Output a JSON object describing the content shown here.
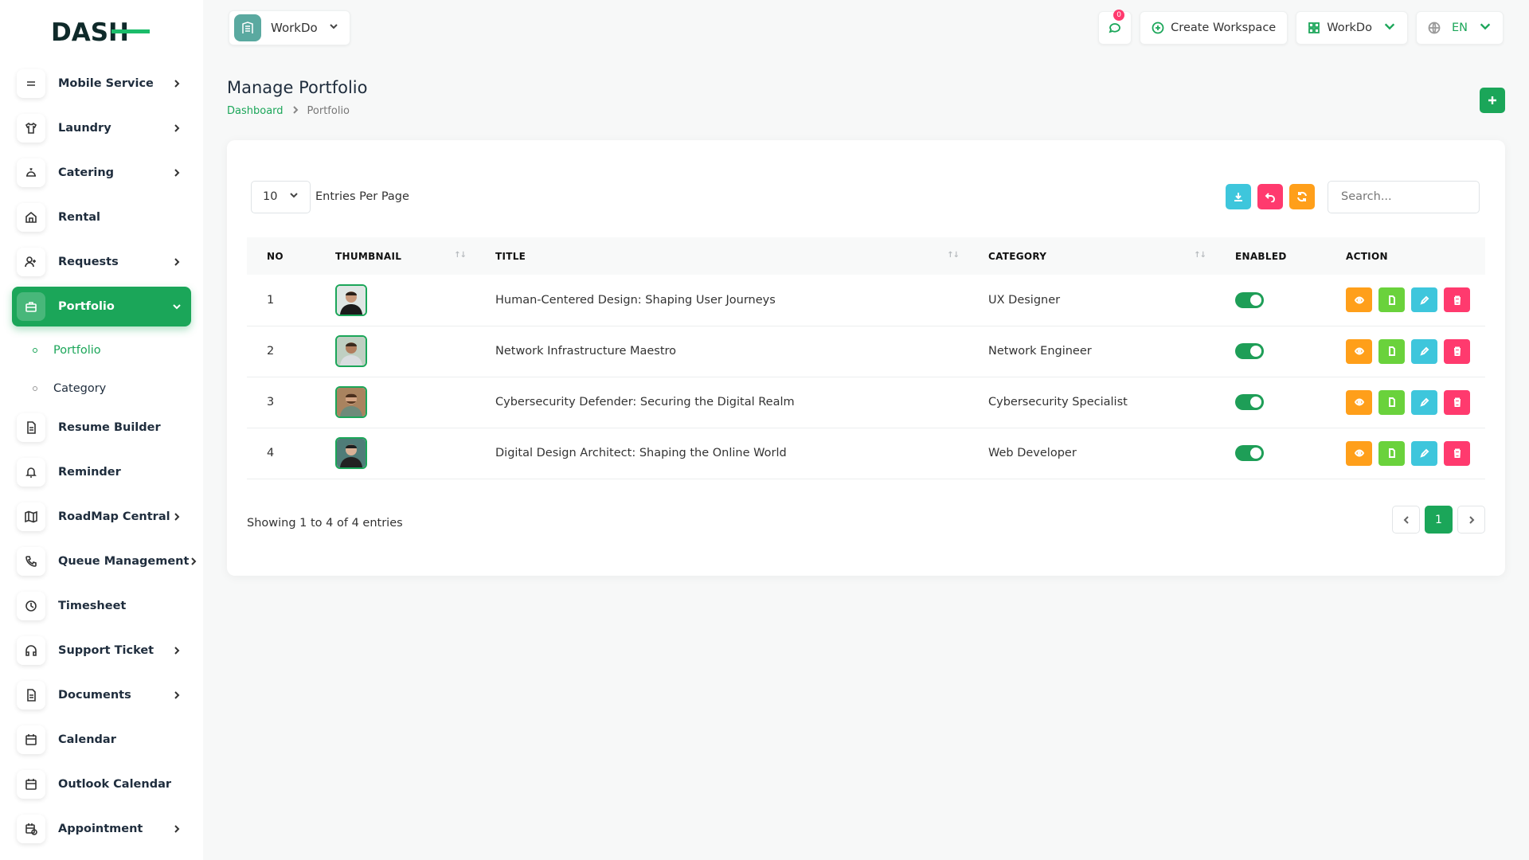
{
  "brand": {
    "logo_main": "DASH",
    "logo_tail": ""
  },
  "sidebar": {
    "items": [
      {
        "label": "Mobile Service",
        "icon": "menu-icon",
        "chevron": true
      },
      {
        "label": "Laundry",
        "icon": "shirt-icon",
        "chevron": true
      },
      {
        "label": "Catering",
        "icon": "tray-icon",
        "chevron": true
      },
      {
        "label": "Rental",
        "icon": "home-icon",
        "chevron": false
      },
      {
        "label": "Requests",
        "icon": "user-plus-icon",
        "chevron": true
      },
      {
        "label": "Portfolio",
        "icon": "briefcase-icon",
        "chevron": true,
        "active": true
      },
      {
        "label": "Resume Builder",
        "icon": "file-icon",
        "chevron": false
      },
      {
        "label": "Reminder",
        "icon": "bell-icon",
        "chevron": false
      },
      {
        "label": "RoadMap Central",
        "icon": "map-icon",
        "chevron": true
      },
      {
        "label": "Queue Management",
        "icon": "phone-icon",
        "chevron": true
      },
      {
        "label": "Timesheet",
        "icon": "clock-icon",
        "chevron": false
      },
      {
        "label": "Support Ticket",
        "icon": "headphones-icon",
        "chevron": true
      },
      {
        "label": "Documents",
        "icon": "file-icon",
        "chevron": true
      },
      {
        "label": "Calendar",
        "icon": "calendar-icon",
        "chevron": false
      },
      {
        "label": "Outlook Calendar",
        "icon": "calendar-icon",
        "chevron": false
      },
      {
        "label": "Appointment",
        "icon": "calendar-clock-icon",
        "chevron": true
      }
    ],
    "subitems": [
      {
        "label": "Portfolio",
        "active": true
      },
      {
        "label": "Category",
        "active": false
      }
    ]
  },
  "header": {
    "workspace": "WorkDo",
    "notification_count": "0",
    "create_workspace": "Create Workspace",
    "workspace_menu": "WorkDo",
    "language": "EN"
  },
  "page": {
    "title": "Manage Portfolio",
    "breadcrumb": [
      "Dashboard",
      "Portfolio"
    ]
  },
  "table": {
    "per_page": "10",
    "per_page_label": "Entries Per Page",
    "search_placeholder": "Search...",
    "columns": [
      "NO",
      "THUMBNAIL",
      "TITLE",
      "CATEGORY",
      "ENABLED",
      "ACTION"
    ],
    "rows": [
      {
        "no": "1",
        "title": "Human-Centered Design: Shaping User Journeys",
        "category": "UX Designer",
        "enabled": true
      },
      {
        "no": "2",
        "title": "Network Infrastructure Maestro",
        "category": "Network Engineer",
        "enabled": true
      },
      {
        "no": "3",
        "title": "Cybersecurity Defender: Securing the Digital Realm",
        "category": "Cybersecurity Specialist",
        "enabled": true
      },
      {
        "no": "4",
        "title": "Digital Design Architect: Shaping the Online World",
        "category": "Web Developer",
        "enabled": true
      }
    ],
    "showing": "Showing 1 to 4 of 4 entries",
    "current_page": "1"
  },
  "colors": {
    "accent": "#1ba659",
    "orange": "#ff9f1a",
    "pink": "#ff3a6e",
    "cyan": "#3ec6dc",
    "lime": "#6ad23c"
  }
}
